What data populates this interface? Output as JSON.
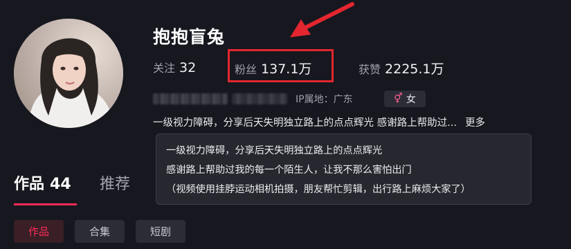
{
  "profile": {
    "username": "抱抱盲兔",
    "stats": {
      "following_label": "关注",
      "following_value": "32",
      "followers_label": "粉丝",
      "followers_value": "137.1万",
      "likes_label": "获赞",
      "likes_value": "2225.1万"
    },
    "ip_location": "IP属地：广东",
    "gender": "女",
    "bio_preview": "一级视力障碍，分享后天失明独立路上的点点辉光 感谢路上帮助过...",
    "more_label": "更多",
    "bio_full": [
      "一级视力障碍，分享后天失明独立路上的点点辉光",
      "感谢路上帮助过我的每一个陌生人，让我不那么害怕出门",
      "（视频使用挂脖运动相机拍摄，朋友帮忙剪辑，出行路上麻烦大家了）"
    ]
  },
  "tabs": {
    "works_label": "作品",
    "works_count": "44",
    "recommend_label": "推荐"
  },
  "filters": [
    "作品",
    "合集",
    "短剧"
  ],
  "colors": {
    "background": "#16171f",
    "highlight": "#e3262f",
    "accent": "#fe2c55"
  },
  "icons": {
    "gender": "female-symbol-icon",
    "annotation": "red-arrow-icon"
  }
}
